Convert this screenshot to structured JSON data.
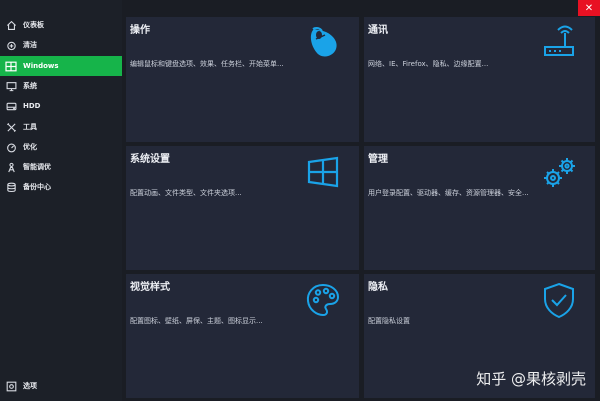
{
  "window": {
    "close_label": "✕"
  },
  "sidebar": {
    "items": [
      {
        "label": "仪表板",
        "icon": "home-icon"
      },
      {
        "label": "清洁",
        "icon": "clean-icon"
      },
      {
        "label": "Windows",
        "icon": "window-icon",
        "active": true
      },
      {
        "label": "系统",
        "icon": "monitor-icon"
      },
      {
        "label": "HDD",
        "icon": "drive-icon"
      },
      {
        "label": "工具",
        "icon": "tools-icon"
      },
      {
        "label": "优化",
        "icon": "gauge-icon"
      },
      {
        "label": "智能调优",
        "icon": "smart-tune-icon"
      },
      {
        "label": "备份中心",
        "icon": "backup-icon"
      }
    ],
    "settings_label": "选项"
  },
  "tiles": [
    {
      "title": "操作",
      "desc": "编辑鼠标和键盘选项、效果、任务栏、开始菜单...",
      "icon": "mouse-icon"
    },
    {
      "title": "通讯",
      "desc": "网络、IE、Firefox、隐私、边缘配置...",
      "icon": "router-icon"
    },
    {
      "title": "系统设置",
      "desc": "配置动画、文件类型、文件夹选项...",
      "icon": "windows-logo-icon"
    },
    {
      "title": "管理",
      "desc": "用户登录配置、驱动器、缓存、资源管理器、安全...",
      "icon": "gears-icon"
    },
    {
      "title": "视觉样式",
      "desc": "配置图标、壁纸、屏保、主题、图标显示...",
      "icon": "palette-icon"
    },
    {
      "title": "隐私",
      "desc": "配置隐私设置",
      "icon": "shield-check-icon"
    }
  ],
  "watermark": "知乎 @果核剥壳",
  "colors": {
    "accent": "#16b44a",
    "icon": "#1aa3e8",
    "tile": "#232838",
    "close": "#e81123"
  }
}
